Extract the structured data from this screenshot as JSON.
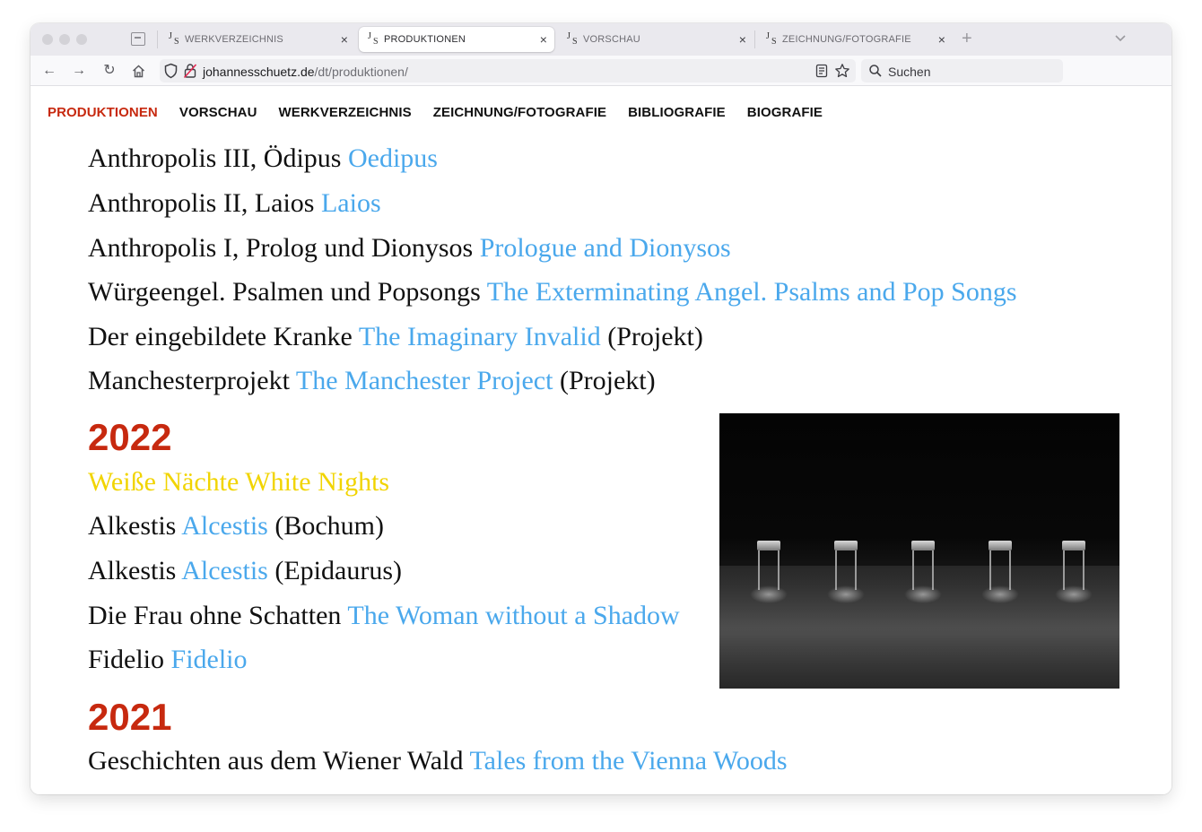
{
  "browser": {
    "tabs": [
      {
        "favicon_j": "J",
        "favicon_s": "S",
        "label": "WERKVERZEICHNIS",
        "close": "×"
      },
      {
        "favicon_j": "J",
        "favicon_s": "S",
        "label": "PRODUKTIONEN",
        "close": "×"
      },
      {
        "favicon_j": "J",
        "favicon_s": "S",
        "label": "VORSCHAU",
        "close": "×"
      },
      {
        "favicon_j": "J",
        "favicon_s": "S",
        "label": "ZEICHNUNG/FOTOGRAFIE",
        "close": "×"
      }
    ],
    "active_tab": "PRODUKTIONEN",
    "new_tab": "+",
    "nav": {
      "back": "←",
      "forward": "→",
      "reload": "↻"
    },
    "url": {
      "domain": "johannesschuetz.de",
      "path": "/dt/produktionen/"
    },
    "search_placeholder": "Suchen"
  },
  "site_nav": [
    "PRODUKTIONEN",
    "VORSCHAU",
    "WERKVERZEICHNIS",
    "ZEICHNUNG/FOTOGRAFIE",
    "BIBLIOGRAFIE",
    "BIOGRAFIE"
  ],
  "entries_top": [
    {
      "de": "Anthropolis III, Ödipus",
      "en": "Oedipus",
      "note": ""
    },
    {
      "de": "Anthropolis II, Laios",
      "en": "Laios",
      "note": ""
    },
    {
      "de": "Anthropolis I, Prolog und Dionysos",
      "en": "Prologue and Dionysos",
      "note": ""
    },
    {
      "de": "Würgeengel. Psalmen und Popsongs",
      "en": "The Exterminating Angel. Psalms and Pop Songs",
      "note": ""
    },
    {
      "de": "Der eingebildete Kranke",
      "en": "The Imaginary Invalid",
      "note": "(Projekt)"
    },
    {
      "de": "Manchesterprojekt",
      "en": "The Manchester Project",
      "note": "(Projekt)"
    }
  ],
  "year_2022": "2022",
  "entries_2022": [
    {
      "highlight": "Weiße Nächte White Nights"
    },
    {
      "de": "Alkestis",
      "en": "Alcestis",
      "note": "(Bochum)"
    },
    {
      "de": "Alkestis",
      "en": "Alcestis",
      "note": "(Epidaurus)"
    },
    {
      "de": "Die Frau ohne Schatten",
      "en": "The Woman without a Shadow",
      "note": ""
    },
    {
      "de": "Fidelio",
      "en": "Fidelio",
      "note": ""
    }
  ],
  "year_2021": "2021",
  "entries_2021": [
    {
      "de": "Geschichten aus dem Wiener Wald",
      "en": "Tales from the Vienna Woods",
      "note": ""
    }
  ],
  "colors": {
    "accent_red": "#c7290f",
    "link_blue": "#4aa8ec",
    "highlight_yellow": "#f1d400"
  }
}
